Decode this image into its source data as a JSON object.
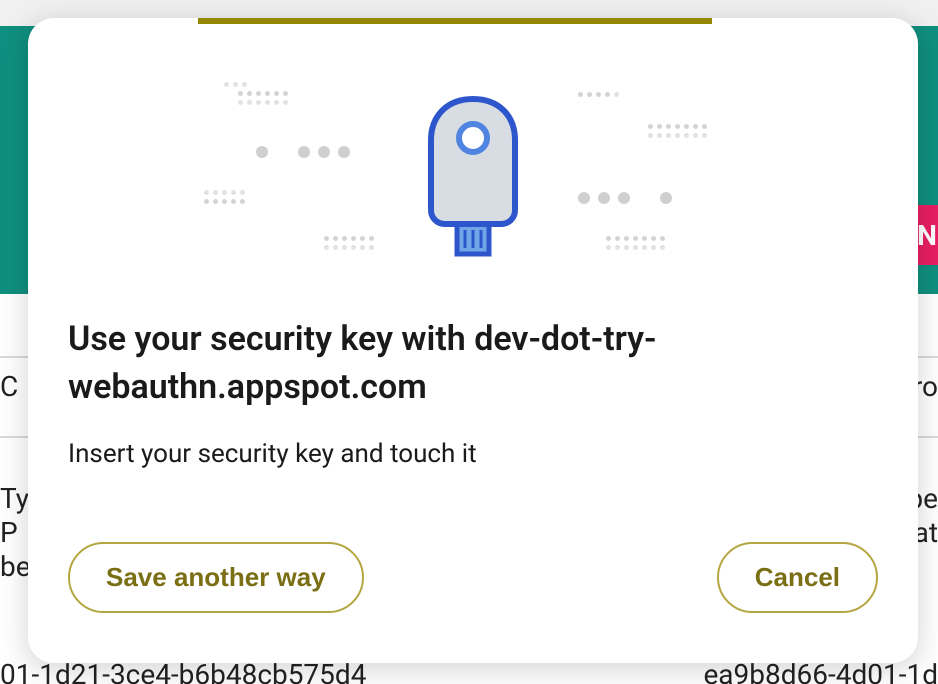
{
  "modal": {
    "title": "Use your security key with dev-dot-try-webauthn.appspot.com",
    "subtitle": "Insert your security key and touch it",
    "buttons": {
      "save_another_way": "Save another way",
      "cancel": "Cancel"
    }
  },
  "background": {
    "fragments": {
      "left_c": "C",
      "right_ro": "ro",
      "left_ty": "Ty",
      "right_pe": "pe",
      "left_p": " P",
      "right_at": "at",
      "left_be": "be",
      "id_left": "01-1d21-3ce4-b6b48cb575d4",
      "id_right": "ea9b8d66-4d01-1d"
    },
    "pink_tab_char": "N"
  },
  "colors": {
    "accent_yellow": "#948700",
    "teal": "#0f8f7f",
    "pink": "#e91e63",
    "key_blue": "#2e56cc",
    "key_body": "#d8dde3",
    "key_light_blue": "#6fa6e8"
  }
}
